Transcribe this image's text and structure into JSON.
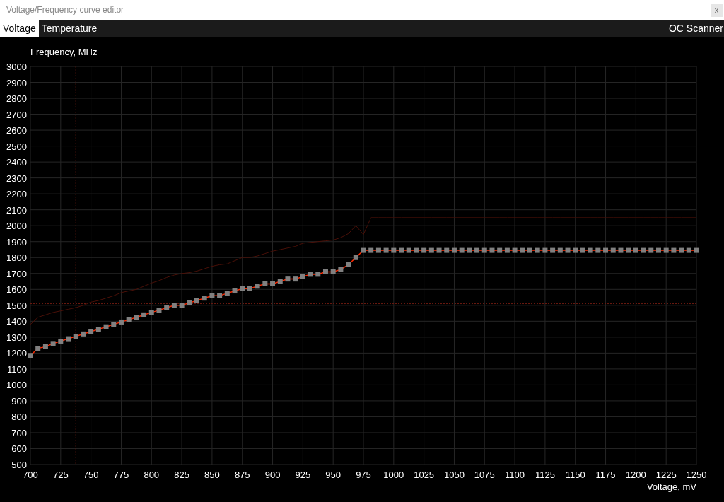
{
  "window": {
    "title": "Voltage/Frequency curve editor",
    "close": "x"
  },
  "tabs": [
    {
      "label": "Voltage",
      "selected": true
    },
    {
      "label": "Temperature",
      "selected": false
    }
  ],
  "oc_scanner": "OC Scanner",
  "chart_data": {
    "type": "line",
    "xlabel": "Voltage, mV",
    "ylabel": "Frequency, MHz",
    "xlim": [
      700,
      1250
    ],
    "ylim": [
      500,
      3000
    ],
    "xticks": [
      700,
      725,
      750,
      775,
      800,
      825,
      850,
      875,
      900,
      925,
      950,
      975,
      1000,
      1025,
      1050,
      1075,
      1100,
      1125,
      1150,
      1175,
      1200,
      1225,
      1250
    ],
    "yticks": [
      500,
      600,
      700,
      800,
      900,
      1000,
      1100,
      1200,
      1300,
      1400,
      1500,
      1600,
      1700,
      1800,
      1900,
      2000,
      2100,
      2200,
      2300,
      2400,
      2500,
      2600,
      2700,
      2800,
      2900,
      3000
    ],
    "x": [
      700,
      706.25,
      712.5,
      718.75,
      725,
      731.25,
      737.5,
      743.75,
      750,
      756.25,
      762.5,
      768.75,
      775,
      781.25,
      787.5,
      793.75,
      800,
      806.25,
      812.5,
      818.75,
      825,
      831.25,
      837.5,
      843.75,
      850,
      856.25,
      862.5,
      868.75,
      875,
      881.25,
      887.5,
      893.75,
      900,
      906.25,
      912.5,
      918.75,
      925,
      931.25,
      937.5,
      943.75,
      950,
      956.25,
      962.5,
      968.75,
      975,
      981.25,
      987.5,
      993.75,
      1000,
      1006.25,
      1012.5,
      1018.75,
      1025,
      1031.25,
      1037.5,
      1043.75,
      1050,
      1056.25,
      1062.5,
      1068.75,
      1075,
      1081.25,
      1087.5,
      1093.75,
      1100,
      1106.25,
      1112.5,
      1118.75,
      1125,
      1131.25,
      1137.5,
      1143.75,
      1150,
      1156.25,
      1162.5,
      1168.75,
      1175,
      1181.25,
      1187.5,
      1193.75,
      1200,
      1206.25,
      1212.5,
      1218.75,
      1225,
      1231.25,
      1237.5,
      1243.75,
      1250
    ],
    "grid": true,
    "series": [
      {
        "color": "#4a1008",
        "values": [
          1380,
          1425,
          1440,
          1455,
          1465,
          1475,
          1485,
          1500,
          1520,
          1530,
          1545,
          1560,
          1580,
          1590,
          1600,
          1620,
          1640,
          1655,
          1675,
          1690,
          1700,
          1705,
          1715,
          1730,
          1745,
          1755,
          1760,
          1780,
          1800,
          1800,
          1810,
          1825,
          1840,
          1850,
          1860,
          1870,
          1890,
          1895,
          1900,
          1905,
          1910,
          1925,
          1950,
          2000,
          1945,
          2050,
          2050,
          2050,
          2050,
          2050,
          2050,
          2050,
          2050,
          2050,
          2050,
          2050,
          2050,
          2050,
          2050,
          2050,
          2050,
          2050,
          2050,
          2050,
          2050,
          2050,
          2050,
          2050,
          2050,
          2050,
          2050,
          2050,
          2050,
          2050,
          2050,
          2050,
          2050,
          2050,
          2050,
          2050,
          2050,
          2050,
          2050,
          2050,
          2050,
          2050,
          2050,
          2050,
          2050
        ]
      },
      {
        "color": "#ff2a00",
        "marker": "square",
        "values": [
          1185,
          1230,
          1240,
          1260,
          1275,
          1290,
          1305,
          1320,
          1335,
          1350,
          1365,
          1380,
          1395,
          1410,
          1425,
          1440,
          1455,
          1470,
          1485,
          1500,
          1500,
          1515,
          1530,
          1545,
          1560,
          1560,
          1575,
          1590,
          1605,
          1605,
          1620,
          1635,
          1635,
          1650,
          1665,
          1665,
          1680,
          1695,
          1695,
          1710,
          1710,
          1725,
          1755,
          1800,
          1845,
          1845,
          1845,
          1845,
          1845,
          1845,
          1845,
          1845,
          1845,
          1845,
          1845,
          1845,
          1845,
          1845,
          1845,
          1845,
          1845,
          1845,
          1845,
          1845,
          1845,
          1845,
          1845,
          1845,
          1845,
          1845,
          1845,
          1845,
          1845,
          1845,
          1845,
          1845,
          1845,
          1845,
          1845,
          1845,
          1845,
          1845,
          1845,
          1845,
          1845,
          1845,
          1845,
          1845,
          1845
        ]
      }
    ],
    "ref_lines": [
      {
        "axis": "x",
        "value": 737.5
      },
      {
        "axis": "y",
        "value": 1510
      }
    ]
  }
}
